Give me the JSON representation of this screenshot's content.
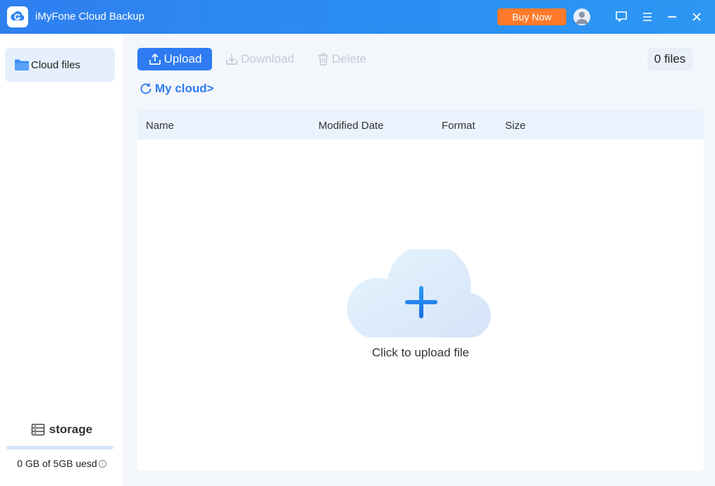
{
  "titlebar": {
    "title": "iMyFone Cloud Backup",
    "buy_label": "Buy Now",
    "icons": [
      "app-logo-icon",
      "user-avatar-icon",
      "feedback-icon",
      "menu-icon",
      "minimize-icon",
      "close-icon"
    ]
  },
  "sidebar": {
    "items": [
      {
        "label": "Cloud files",
        "icon": "folder-icon"
      }
    ],
    "storage": {
      "title": "storage",
      "usage": "0 GB of 5GB uesd",
      "used_fraction": 0
    }
  },
  "toolbar": {
    "upload_label": "Upload",
    "download_label": "Download",
    "delete_label": "Delete",
    "files_count": "0 files"
  },
  "breadcrumb": {
    "label": "My cloud>"
  },
  "table": {
    "columns": [
      "Name",
      "Modified Date",
      "Format",
      "Size"
    ],
    "rows": []
  },
  "empty_state": {
    "label": "Click to upload file"
  },
  "colors": {
    "accent": "#2e7bf2",
    "buy_button": "#ff7a2a",
    "disabled": "#c5ccd8"
  }
}
